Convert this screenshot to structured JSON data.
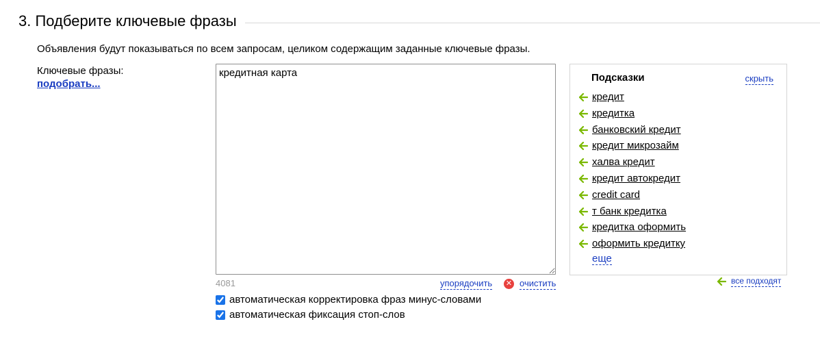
{
  "section": {
    "title": "3. Подберите ключевые фразы",
    "description": "Объявления будут показываться по всем запросам, целиком содержащим заданные ключевые фразы."
  },
  "keywords": {
    "label": "Ключевые фразы:",
    "pick_link": "подобрать...",
    "textarea_value": "кредитная карта",
    "counter": "4081",
    "sort_label": "упорядочить",
    "clear_label": "очистить",
    "clear_icon": "close-circle-icon"
  },
  "options": [
    {
      "label": "автоматическая корректировка фраз минус-словами",
      "checked": true
    },
    {
      "label": "автоматическая фиксация стоп-слов",
      "checked": true
    }
  ],
  "hints": {
    "title": "Подсказки",
    "hide_label": "скрыть",
    "arrow_icon": "arrow-left-icon",
    "arrow_color": "#7ab800",
    "items": [
      "кредит",
      "кредитка",
      "банковский кредит",
      "кредит микрозайм",
      "халва кредит",
      "кредит автокредит",
      "credit card",
      "т банк кредитка",
      "кредитка оформить",
      "оформить кредитку"
    ],
    "more_label": "еще",
    "all_fit_label": "все подходят"
  },
  "colors": {
    "link": "#1a3dc1",
    "arrow": "#7ab800",
    "clear_icon": "#e8413e"
  }
}
